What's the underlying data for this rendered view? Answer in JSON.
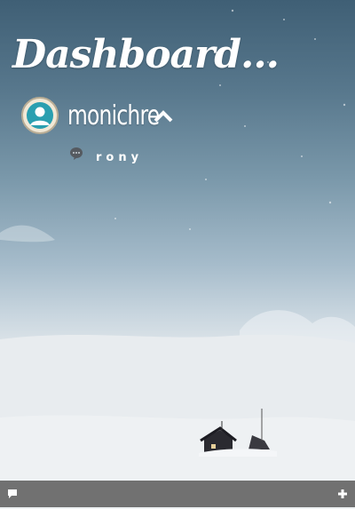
{
  "header": {
    "title": "Dashboard..."
  },
  "profile": {
    "username": "monichre",
    "subname": "rony"
  },
  "icons": {
    "avatar": "user-avatar-icon",
    "caret": "chevron-up-icon",
    "chat": "chat-bubble-icon",
    "bottom_left": "comment-icon",
    "bottom_right": "plus-icon"
  },
  "colors": {
    "avatar_accent": "#2a9fb0",
    "bar_background": "#666666",
    "text": "#ffffff"
  }
}
